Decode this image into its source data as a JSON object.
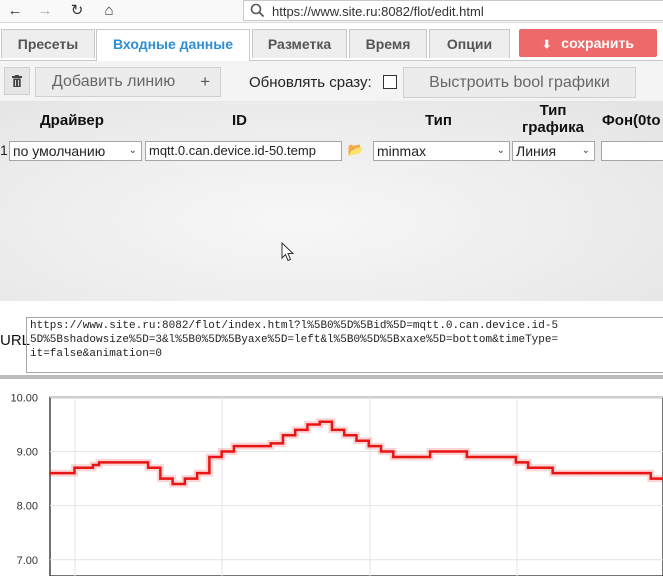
{
  "browser": {
    "url": "https://www.site.ru:8082/flot/edit.html"
  },
  "tabs": [
    {
      "label": "Пресеты"
    },
    {
      "label": "Входные данные"
    },
    {
      "label": "Разметка"
    },
    {
      "label": "Время"
    },
    {
      "label": "Опции"
    }
  ],
  "save_label": "сохранить",
  "toolbar": {
    "add_line_label": "Добавить линию",
    "add_line_plus": "+",
    "refresh_label": "Обновлять сразу:",
    "bool_label": "Выстроить bool графики"
  },
  "table": {
    "headers": {
      "driver": "Драйвер",
      "id": "ID",
      "type": "Тип",
      "chart_type_line1": "Тип",
      "chart_type_line2": "графика",
      "background": "Фон(0to"
    },
    "row": {
      "num": "1",
      "driver": "по умолчанию",
      "id": "mqtt.0.can.device.id-50.temp",
      "type": "minmax",
      "chart_type": "Линия",
      "background": ""
    }
  },
  "url_section": {
    "label": "URL",
    "line1": "https://www.site.ru:8082/flot/index.html?l%5B0%5D%5Bid%5D=mqtt.0.can.device.id-5",
    "line2": "5D%5Bshadowsize%5D=3&l%5B0%5D%5Byaxe%5D=left&l%5B0%5D%5Bxaxe%5D=bottom&timeType=",
    "line3": "it=false&animation=0"
  },
  "chart_data": {
    "type": "line",
    "yticks": [
      "10.00",
      "9.00",
      "8.00",
      "7.00"
    ],
    "ylim": [
      6.7,
      10.1
    ],
    "grid": true,
    "series": [
      {
        "color": "#e81515",
        "x": [
          0,
          2,
          4,
          6,
          7,
          8,
          10,
          12,
          14,
          16,
          18,
          20,
          22,
          24,
          26,
          28,
          30,
          32,
          34,
          36,
          38,
          40,
          42,
          44,
          46,
          48,
          50,
          52,
          54,
          56,
          58,
          60,
          62,
          64,
          66,
          68,
          70,
          72,
          74,
          76,
          78,
          80,
          82,
          84,
          86,
          88,
          90,
          92,
          94,
          96,
          98,
          100
        ],
        "y": [
          8.6,
          8.6,
          8.7,
          8.7,
          8.75,
          8.8,
          8.8,
          8.8,
          8.8,
          8.7,
          8.5,
          8.4,
          8.5,
          8.6,
          8.9,
          9.0,
          9.1,
          9.1,
          9.1,
          9.15,
          9.3,
          9.4,
          9.5,
          9.55,
          9.4,
          9.3,
          9.2,
          9.1,
          9.0,
          8.9,
          8.9,
          8.9,
          9.0,
          9.0,
          9.0,
          8.9,
          8.9,
          8.9,
          8.9,
          8.8,
          8.7,
          8.7,
          8.6,
          8.6,
          8.6,
          8.6,
          8.6,
          8.6,
          8.6,
          8.6,
          8.5,
          8.5
        ]
      }
    ]
  }
}
